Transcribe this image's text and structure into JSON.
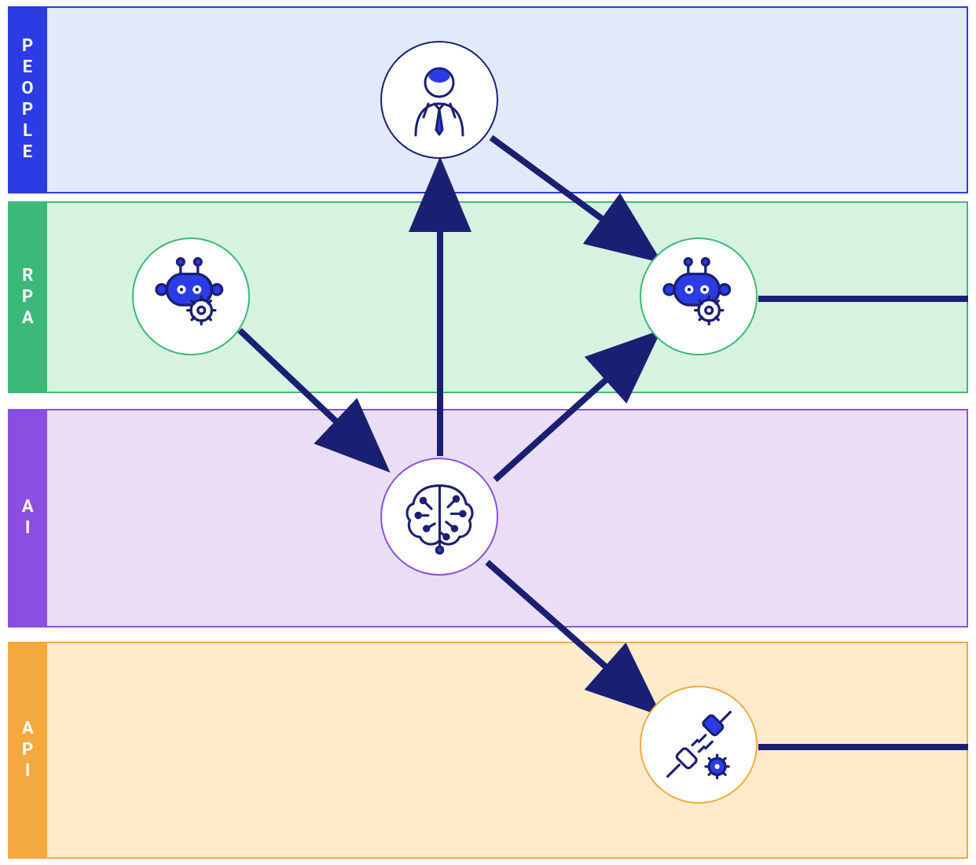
{
  "lanes": {
    "people": {
      "label": "PEOPLE",
      "tabColor": "#2B3CE5",
      "bodyColor": "#E0EAFB"
    },
    "rpa": {
      "label": "RPA",
      "tabColor": "#3CB87A",
      "bodyColor": "#D6F3E2"
    },
    "ai": {
      "label": "AI",
      "tabColor": "#8A4FE0",
      "bodyColor": "#EADEF7"
    },
    "api": {
      "label": "API",
      "tabColor": "#F4A93E",
      "bodyColor": "#FDEBCB"
    }
  },
  "nodes": {
    "person": {
      "lane": "people",
      "icon": "person-icon",
      "borderColor": "#1A1F71"
    },
    "robot1": {
      "lane": "rpa",
      "icon": "robot-icon",
      "borderColor": "#3CB87A"
    },
    "robot2": {
      "lane": "rpa",
      "icon": "robot-icon",
      "borderColor": "#3CB87A"
    },
    "brain": {
      "lane": "ai",
      "icon": "brain-icon",
      "borderColor": "#8A4FE0"
    },
    "plug": {
      "lane": "api",
      "icon": "plug-icon",
      "borderColor": "#F4A93E"
    }
  },
  "edges": [
    {
      "from": "robot1",
      "to": "brain",
      "color": "#1A1F71"
    },
    {
      "from": "brain",
      "to": "person",
      "color": "#1A1F71"
    },
    {
      "from": "brain",
      "to": "robot2",
      "color": "#1A1F71"
    },
    {
      "from": "brain",
      "to": "plug",
      "color": "#1A1F71"
    },
    {
      "from": "person",
      "to": "robot2",
      "color": "#1A1F71"
    },
    {
      "from": "robot2",
      "to": "right-edge",
      "color": "#1A1F71",
      "arrow": false
    },
    {
      "from": "plug",
      "to": "right-edge",
      "color": "#1A1F71",
      "arrow": false
    }
  ],
  "colors": {
    "arrow": "#1A1F71",
    "iconPrimary": "#2B3CE5",
    "iconStroke": "#1A1F71"
  }
}
